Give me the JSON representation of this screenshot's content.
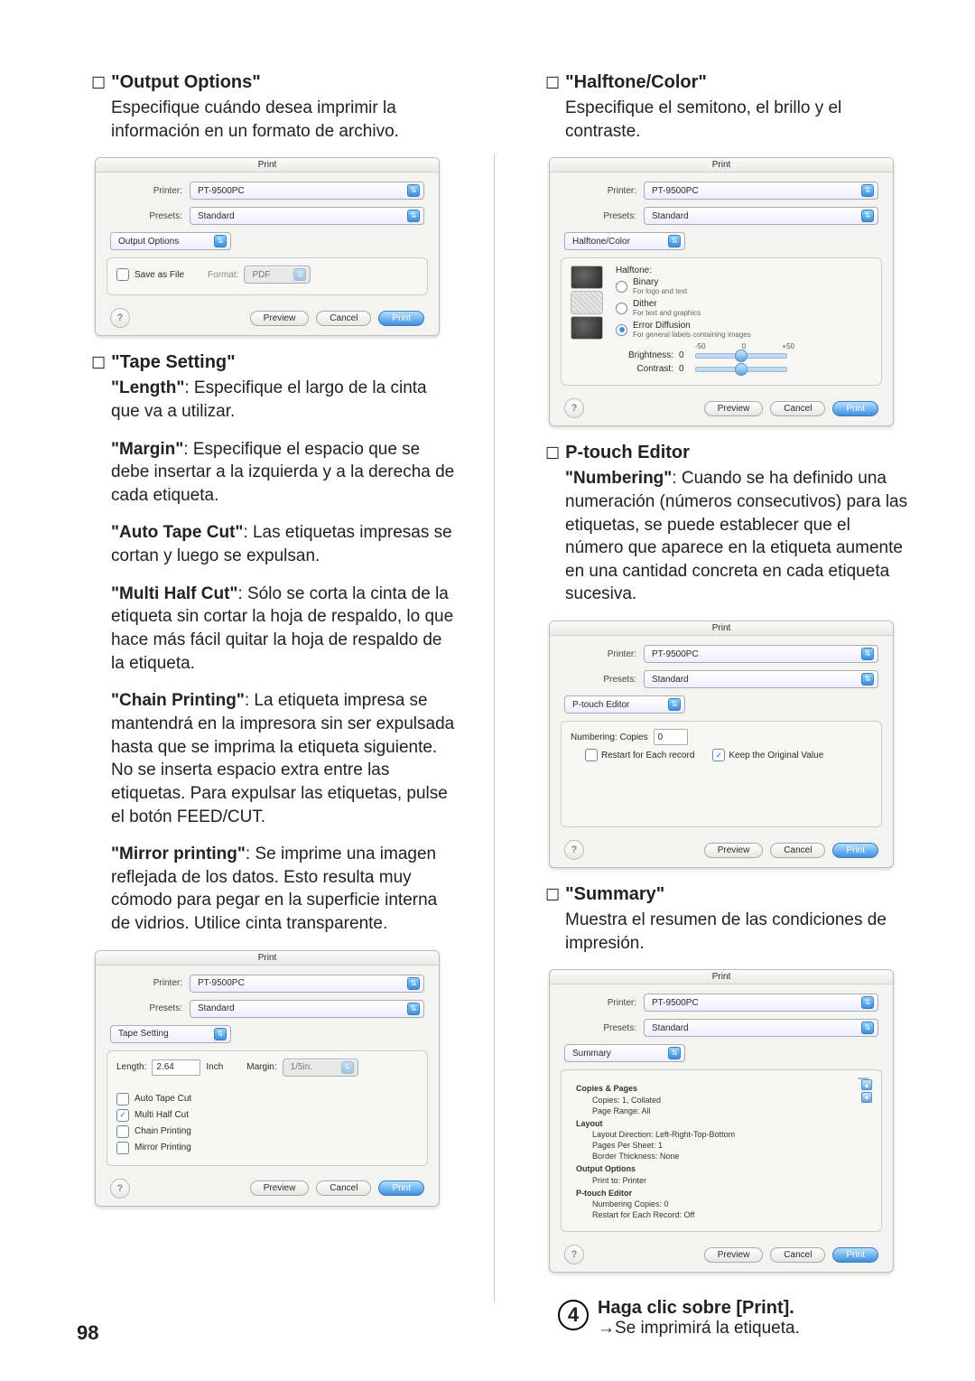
{
  "page_number": "98",
  "left": {
    "output_options": {
      "title": "\"Output Options\"",
      "desc": "Especifique cuándo desea imprimir la información en un formato de archivo."
    },
    "tape_setting": {
      "title": "\"Tape Setting\"",
      "length": "\"Length\": Especifique el largo de la cinta que va a utilizar.",
      "margin": "\"Margin\": Especifique el espacio que se debe insertar a la izquierda y a la derecha de cada etiqueta.",
      "autocut": "\"Auto Tape Cut\": Las etiquetas impresas se cortan y luego se expulsan.",
      "multihalf": "\"Multi Half Cut\": Sólo se corta la cinta de la etiqueta sin cortar la hoja de respaldo, lo que hace más fácil quitar la hoja de respaldo de la etiqueta.",
      "chain": "\"Chain Printing\": La etiqueta impresa se mantendrá en la impresora sin ser expulsada hasta que se imprima la etiqueta siguiente. No se inserta espacio extra entre las etiquetas. Para expulsar las etiquetas, pulse el botón FEED/CUT.",
      "mirror": "\"Mirror printing\": Se imprime una imagen reflejada de los datos. Esto resulta muy cómodo para pegar en la superficie interna de vidrios. Utilice cinta transparente."
    }
  },
  "right": {
    "halftone": {
      "title": "\"Halftone/Color\"",
      "desc": "Especifique el semitono, el brillo y el contraste."
    },
    "ptouch": {
      "title": "P-touch Editor",
      "desc": "\"Numbering\": Cuando se ha definido una numeración (números consecutivos) para las etiquetas, se puede establecer que el número que aparece en la etiqueta aumente en una cantidad concreta en cada etiqueta sucesiva."
    },
    "summary": {
      "title": "\"Summary\"",
      "desc": "Muestra el resumen de las condiciones de impresión."
    }
  },
  "dialog_common": {
    "title": "Print",
    "printer_label": "Printer:",
    "printer_value": "PT-9500PC",
    "presets_label": "Presets:",
    "presets_value": "Standard",
    "preview": "Preview",
    "cancel": "Cancel",
    "print": "Print"
  },
  "dlg_output": {
    "tab": "Output Options",
    "save_as_file": "Save as File",
    "format_label": "Format:",
    "format_value": "PDF"
  },
  "dlg_tape": {
    "tab": "Tape Setting",
    "length_label": "Length:",
    "length_value": "2.64",
    "unit": "Inch",
    "margin_label": "Margin:",
    "margin_value": "1/5in.",
    "auto_tape_cut": "Auto Tape Cut",
    "multi_half_cut": "Multi Half Cut",
    "chain_printing": "Chain Printing",
    "mirror_printing": "Mirror Printing"
  },
  "dlg_halftone": {
    "tab": "Halftone/Color",
    "halftone_label": "Halftone:",
    "binary": "Binary",
    "binary_sub": "For logo and text",
    "dither": "Dither",
    "dither_sub": "For text and graphics",
    "error_diff": "Error Diffusion",
    "error_diff_sub": "For general labels containing images",
    "brightness_label": "Brightness:",
    "brightness_value": "0",
    "contrast_label": "Contrast:",
    "contrast_value": "0",
    "tick_neg": "-50",
    "tick_zero": "0",
    "tick_pos": "+50"
  },
  "dlg_ptouch": {
    "tab": "P-touch Editor",
    "numbering_label": "Numbering: Copies",
    "numbering_value": "0",
    "restart": "Restart for Each record",
    "keep_original": "Keep the Original Value"
  },
  "dlg_summary": {
    "tab": "Summary",
    "groups": {
      "copies_pages": "Copies & Pages",
      "copies": "Copies:  1, Collated",
      "page_range": "Page Range:   All",
      "layout": "Layout",
      "layout_dir": "Layout Direction:   Left-Right-Top-Bottom",
      "pages_per_sheet": "Pages Per Sheet:   1",
      "border": "Border Thickness:   None",
      "output_options": "Output Options",
      "print_to": "Print to:   Printer",
      "ptouch_editor": "P-touch Editor",
      "num_copies": "Numbering Copies:   0",
      "restart": "Restart for Each Record:   Off"
    }
  },
  "step4": {
    "num": "4",
    "heading": "Haga clic sobre [Print].",
    "sub": "→Se imprimirá la etiqueta."
  }
}
